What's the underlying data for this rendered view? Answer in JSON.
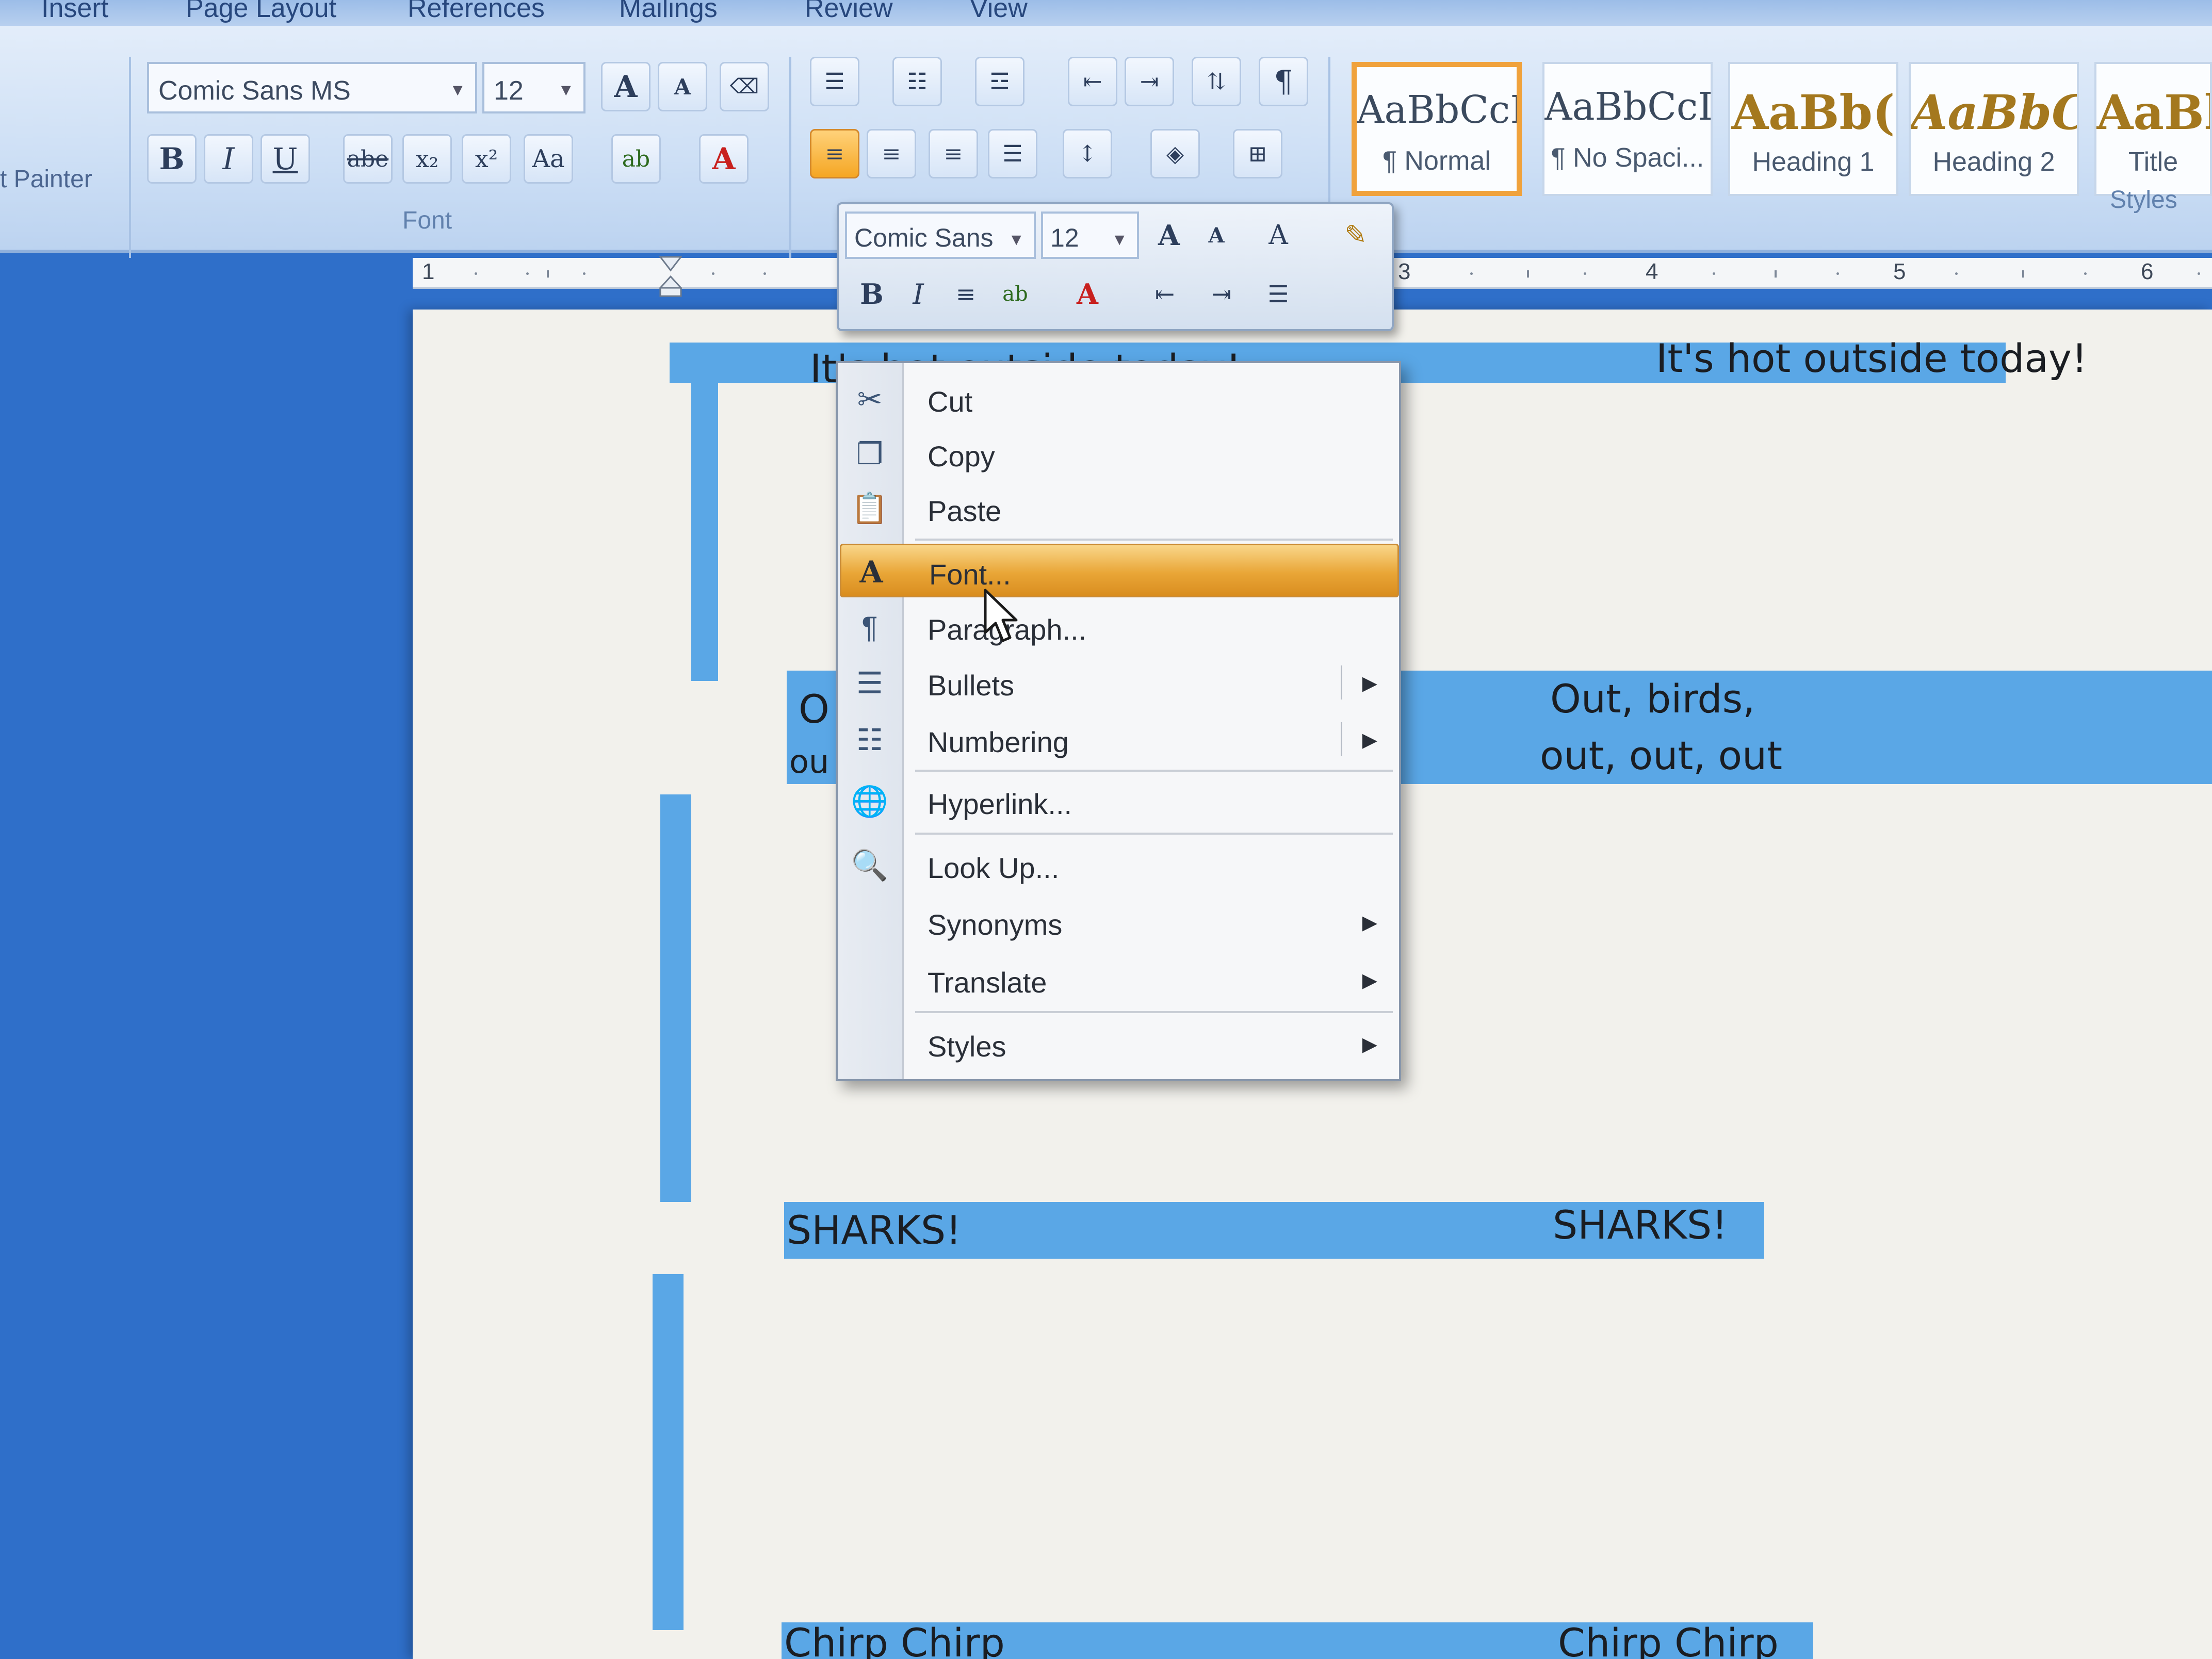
{
  "ribbon": {
    "tabs": [
      "Insert",
      "Page Layout",
      "References",
      "Mailings",
      "Review",
      "View"
    ],
    "clipboard": {
      "format_painter_label": "t Painter"
    },
    "font_group": {
      "font_name": "Comic Sans MS",
      "font_size": "12",
      "label": "Font",
      "grow_font_label": "A",
      "shrink_font_label": "A",
      "bold_label": "B",
      "italic_label": "I",
      "underline_label": "U",
      "strike_label": "abe",
      "subscript_label": "x₂",
      "superscript_label": "x²",
      "change_case_label": "Aa",
      "font_color_label": "A"
    },
    "paragraph_group": {
      "show_marks_label": "¶"
    },
    "styles_group": {
      "label": "Styles",
      "styles": [
        {
          "sample": "AaBbCcI",
          "name": "¶ Normal"
        },
        {
          "sample": "AaBbCcI",
          "name": "¶ No Spaci..."
        },
        {
          "sample": "AaBb(",
          "name": "Heading 1"
        },
        {
          "sample": "AaBbC(",
          "name": "Heading 2"
        },
        {
          "sample": "AaBl",
          "name": "Title"
        }
      ]
    }
  },
  "ruler": {
    "numbers": [
      "1",
      "3",
      "4",
      "5",
      "6"
    ]
  },
  "mini_toolbar": {
    "font_name": "Comic Sans",
    "font_size": "12",
    "bold_label": "B",
    "italic_label": "I",
    "grow_label": "A",
    "shrink_label": "A",
    "font_color_label": "A"
  },
  "document": {
    "line1_left": "It's hot outside today!",
    "line1_right": "It's hot outside today!",
    "line2_left_a": "O",
    "line2_left_b": "ou",
    "line2_right_a": "Out, birds,",
    "line2_right_b": "out, out, out",
    "line3_left": "SHARKS!",
    "line3_right": "SHARKS!",
    "line4_left": "Chirp Chirp",
    "line4_right": "Chirp Chirp"
  },
  "context_menu": {
    "items": [
      {
        "label": "Cut",
        "icon": "scissors-icon"
      },
      {
        "label": "Copy",
        "icon": "copy-icon"
      },
      {
        "label": "Paste",
        "icon": "paste-icon"
      },
      {
        "label": "Font...",
        "icon": "font-icon",
        "highlighted": true
      },
      {
        "label": "Paragraph...",
        "icon": "paragraph-icon"
      },
      {
        "label": "Bullets",
        "icon": "bullets-icon",
        "submenu": true
      },
      {
        "label": "Numbering",
        "icon": "numbering-icon",
        "submenu": true
      },
      {
        "label": "Hyperlink...",
        "icon": "hyperlink-icon"
      },
      {
        "label": "Look Up...",
        "icon": "lookup-icon"
      },
      {
        "label": "Synonyms",
        "icon": "",
        "submenu": true
      },
      {
        "label": "Translate",
        "icon": "",
        "submenu": true
      },
      {
        "label": "Styles",
        "icon": "",
        "submenu": true
      }
    ]
  },
  "colors": {
    "highlight": "#e9a637",
    "accent_bar": "#5aa7e6",
    "ribbon": "#cddff5",
    "desktop": "#2f6fc9"
  }
}
